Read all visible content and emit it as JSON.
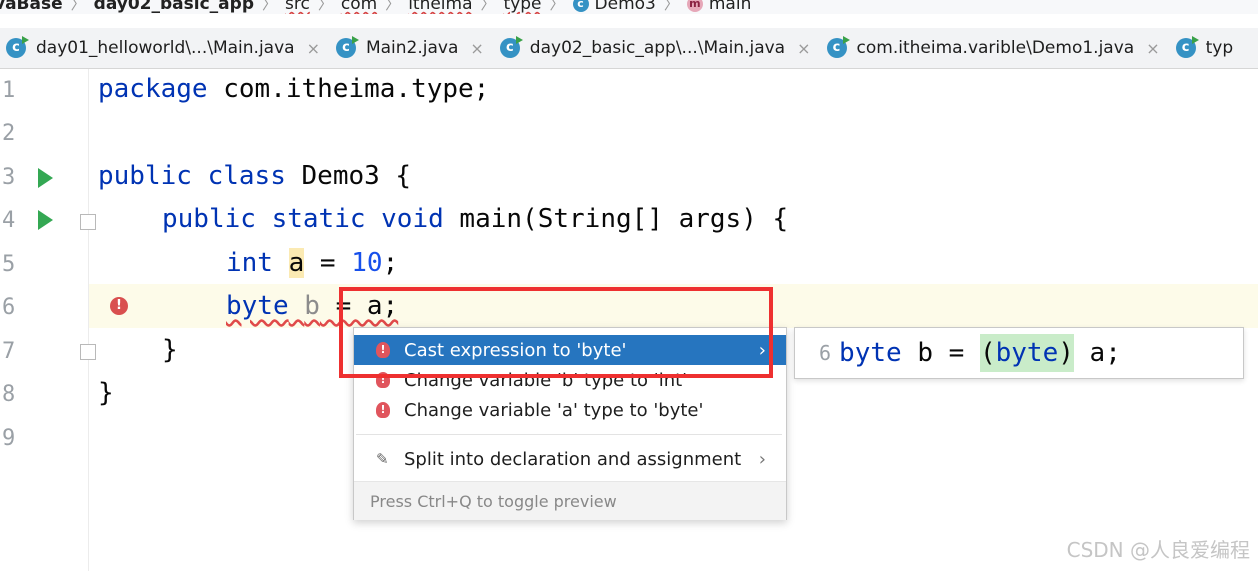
{
  "breadcrumb": [
    "vaBase",
    "day02_basic_app",
    "src",
    "com",
    "itheima",
    "type",
    "Demo3",
    "main"
  ],
  "tabs": [
    {
      "label": "day01_helloworld\\...\\Main.java",
      "icon": "class-run-icon"
    },
    {
      "label": "Main2.java",
      "icon": "class-run-icon"
    },
    {
      "label": "day02_basic_app\\...\\Main.java",
      "icon": "class-run-icon"
    },
    {
      "label": "com.itheima.varible\\Demo1.java",
      "icon": "class-run-icon"
    },
    {
      "label": "typ",
      "icon": "class-run-icon"
    }
  ],
  "close_glyph": "×",
  "editor": {
    "line_numbers": [
      "1",
      "2",
      "3",
      "4",
      "5",
      "6",
      "7",
      "8",
      "9"
    ],
    "code": {
      "l1_kw": "package",
      "l1_rest": " com.itheima.type;",
      "l3_kw1": "public",
      "l3_kw2": "class",
      "l3_rest": " Demo3 {",
      "l4_kw1": "public",
      "l4_kw2": "static",
      "l4_kw3": "void",
      "l4_rest": " main(String[] args) {",
      "l5_kw": "int",
      "l5_var": "a",
      "l5_eq": " = ",
      "l5_num": "10",
      "l5_end": ";",
      "l6_kw": "byte",
      "l6_var": "b",
      "l6_rest": " = a;",
      "l7": "}",
      "l8": "}"
    }
  },
  "intention_popup": {
    "items": [
      {
        "label": "Cast expression to 'byte'",
        "icon": "error-bulb-icon",
        "has_submenu": true,
        "selected": true
      },
      {
        "label": "Change variable 'b' type to 'int'",
        "icon": "error-bulb-icon",
        "has_submenu": false,
        "selected": false
      },
      {
        "label": "Change variable 'a' type to 'byte'",
        "icon": "error-bulb-icon",
        "has_submenu": false,
        "selected": false
      },
      {
        "label": "Split into declaration and assignment",
        "icon": "edit-icon",
        "has_submenu": true,
        "selected": false
      }
    ],
    "footer": "Press Ctrl+Q to toggle preview",
    "submenu_arrow": "›"
  },
  "preview": {
    "line_number": "6",
    "before": "byte",
    "middle": " b = ",
    "cast": "(byte)",
    "after": " a;"
  },
  "watermark": "CSDN @人良爱编程",
  "colors": {
    "keyword": "#0033b3",
    "number": "#1750eb",
    "selection": "#2675bf",
    "error": "#e0555d",
    "annotation_box": "#ee3030",
    "run_icon": "#34a853"
  }
}
